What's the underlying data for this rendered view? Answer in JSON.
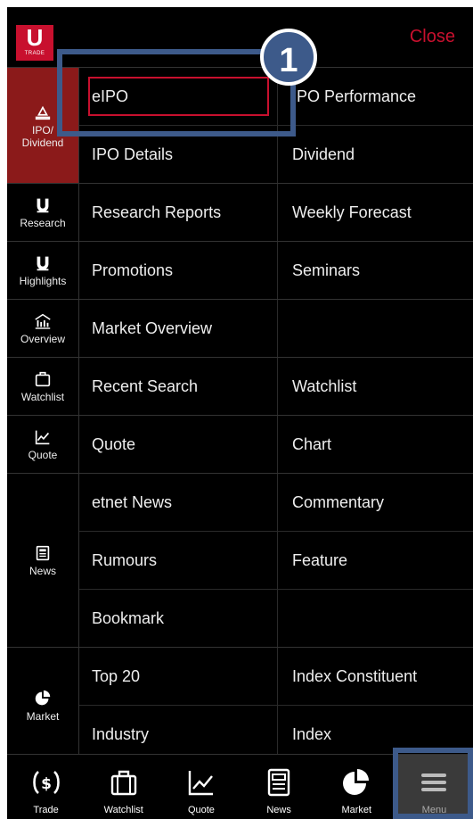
{
  "header": {
    "logo_big": "U",
    "logo_small": "TRADE",
    "close_label": "Close"
  },
  "sections": [
    {
      "id": "ipo",
      "category": [
        "IPO/",
        "Dividend"
      ],
      "icon": "ipo-icon",
      "active": true,
      "rows": [
        [
          "eIPO",
          "IPO Performance"
        ],
        [
          "IPO Details",
          "Dividend"
        ]
      ]
    },
    {
      "id": "research",
      "category": [
        "Research"
      ],
      "icon": "research-logo-icon",
      "active": false,
      "rows": [
        [
          "Research Reports",
          "Weekly Forecast"
        ]
      ]
    },
    {
      "id": "highlights",
      "category": [
        "Highlights"
      ],
      "icon": "highlights-logo-icon",
      "active": false,
      "rows": [
        [
          "Promotions",
          "Seminars"
        ]
      ]
    },
    {
      "id": "overview",
      "category": [
        "Overview"
      ],
      "icon": "overview-icon",
      "active": false,
      "rows": [
        [
          "Market Overview",
          ""
        ]
      ]
    },
    {
      "id": "watchlist",
      "category": [
        "Watchlist"
      ],
      "icon": "watchlist-icon",
      "active": false,
      "rows": [
        [
          "Recent Search",
          "Watchlist"
        ]
      ]
    },
    {
      "id": "quote",
      "category": [
        "Quote"
      ],
      "icon": "quote-chart-icon",
      "active": false,
      "rows": [
        [
          "Quote",
          "Chart"
        ]
      ]
    },
    {
      "id": "news",
      "category": [
        "News"
      ],
      "icon": "news-icon",
      "active": false,
      "rows": [
        [
          "etnet News",
          "Commentary"
        ],
        [
          "Rumours",
          "Feature"
        ],
        [
          "Bookmark",
          ""
        ]
      ]
    },
    {
      "id": "market",
      "category": [
        "Market"
      ],
      "icon": "market-pie-icon",
      "active": false,
      "rows": [
        [
          "Top 20",
          "Index Constituent"
        ],
        [
          "Industry",
          "Index"
        ]
      ]
    }
  ],
  "tabbar": [
    {
      "label": "Trade",
      "icon": "trade-dollar-icon"
    },
    {
      "label": "Watchlist",
      "icon": "watchlist-briefcase-icon"
    },
    {
      "label": "Quote",
      "icon": "quote-chart-icon"
    },
    {
      "label": "News",
      "icon": "news-icon"
    },
    {
      "label": "Market",
      "icon": "market-pie-icon"
    },
    {
      "label": "Menu",
      "icon": "hamburger-menu-icon"
    }
  ],
  "annotation": {
    "step_number": "1",
    "color": "#3d5a8a"
  },
  "colors": {
    "brand_red": "#c8102e",
    "active_category": "#8b1a1a",
    "background": "#000000"
  }
}
